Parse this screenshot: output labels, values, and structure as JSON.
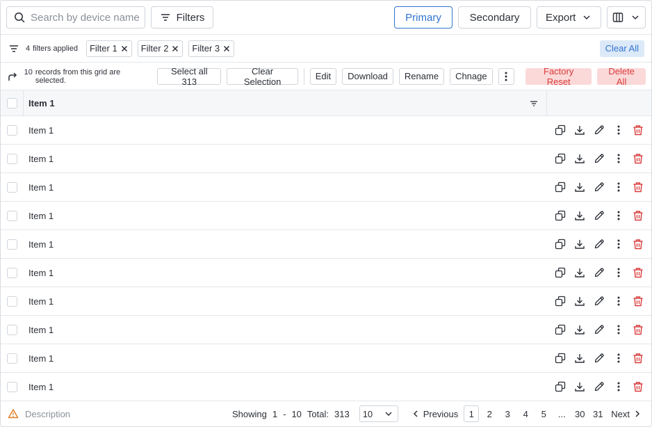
{
  "toolbar": {
    "search_placeholder": "Search by device name",
    "filters_label": "Filters",
    "primary_label": "Primary",
    "secondary_label": "Secondary",
    "export_label": "Export"
  },
  "filters": {
    "count": "4",
    "count_suffix": "filters applied",
    "chips": [
      "Filter 1",
      "Filter 2",
      "Filter 3"
    ],
    "clear_all": "Clear All"
  },
  "selection": {
    "count": "10",
    "text": "records from this grid are selected.",
    "select_all": "Select all 313",
    "clear_selection": "Clear Selection",
    "actions": [
      "Edit",
      "Download",
      "Rename",
      "Chnage"
    ],
    "factory_reset": "Factory Reset",
    "delete_all": "Delete All"
  },
  "table": {
    "header": "Item 1",
    "rows": [
      "Item 1",
      "Item 1",
      "Item 1",
      "Item 1",
      "Item 1",
      "Item 1",
      "Item 1",
      "Item 1",
      "Item 1",
      "Item 1"
    ]
  },
  "footer": {
    "description": "Description",
    "showing_label": "Showing",
    "range_start": "1",
    "range_sep": "-",
    "range_end": "10",
    "total_label": "Total:",
    "total": "313",
    "page_size": "10",
    "previous": "Previous",
    "pages": [
      "1",
      "2",
      "3",
      "4",
      "5",
      "...",
      "30",
      "31"
    ],
    "current_page": "1",
    "next": "Next"
  },
  "colors": {
    "accent": "#2f74d0",
    "danger": "#d93a3a",
    "danger_bg": "#fbd9d9",
    "info_bg": "#dce9f8",
    "warning": "#e07a1f"
  },
  "icons": [
    "search-icon",
    "filter-lines-icon",
    "chevron-down-icon",
    "columns-icon",
    "close-icon",
    "forward-arrow-icon",
    "more-vertical-icon",
    "copy-icon",
    "download-icon",
    "pencil-icon",
    "trash-icon",
    "warning-icon",
    "chevron-left-icon",
    "chevron-right-icon"
  ]
}
